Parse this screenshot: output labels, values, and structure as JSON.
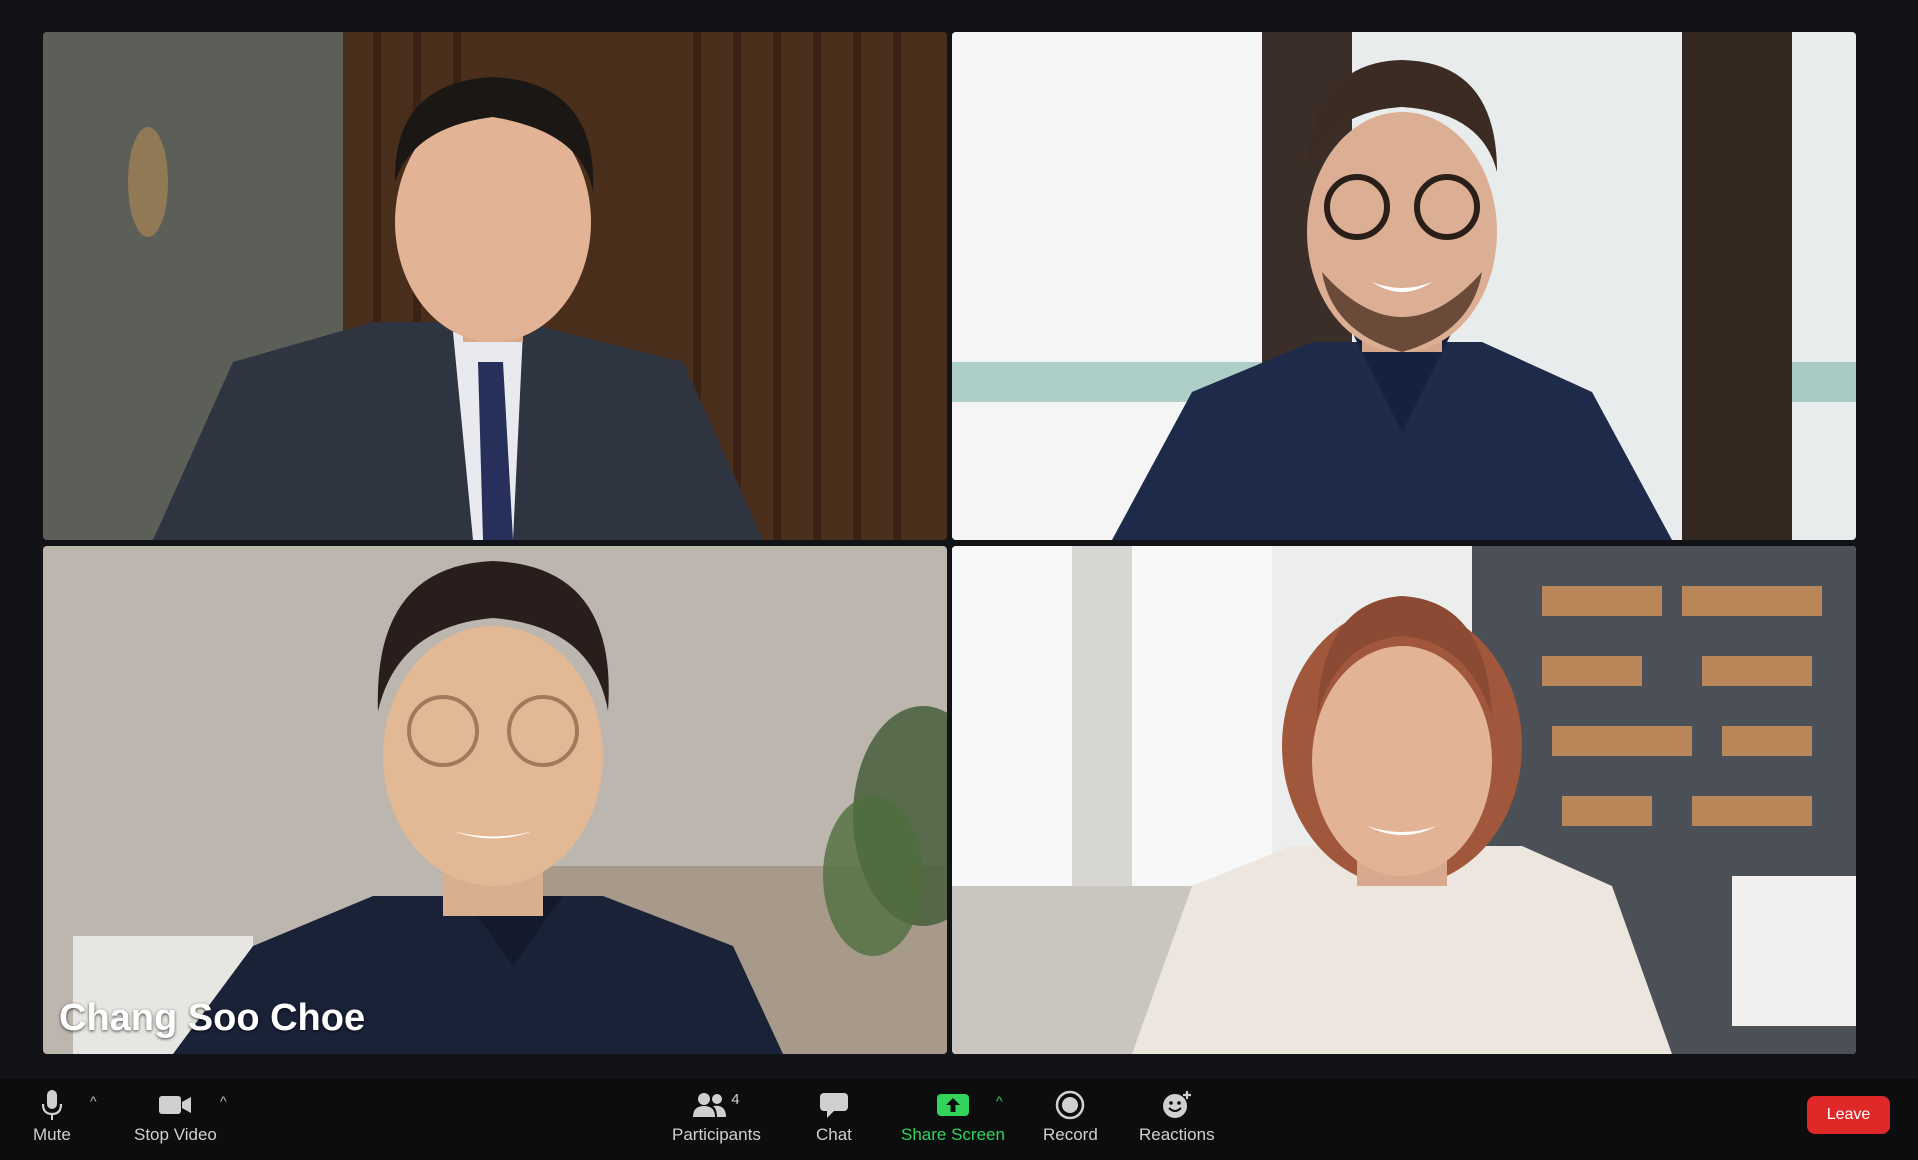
{
  "participants": [
    {
      "name": ""
    },
    {
      "name": ""
    },
    {
      "name": "Chang Soo Choe"
    },
    {
      "name": ""
    }
  ],
  "toolbar": {
    "mute_label": "Mute",
    "stop_video_label": "Stop Video",
    "participants_label": "Participants",
    "participants_count": "4",
    "chat_label": "Chat",
    "share_screen_label": "Share Screen",
    "record_label": "Record",
    "reactions_label": "Reactions",
    "leave_label": "Leave"
  },
  "icons": {
    "mute": "microphone-icon",
    "video": "video-camera-icon",
    "participants": "people-icon",
    "chat": "chat-bubble-icon",
    "share": "share-screen-icon",
    "record": "record-icon",
    "reactions": "smiley-plus-icon"
  },
  "colors": {
    "active_speaker": "#2ecc52",
    "share_green": "#33d35c",
    "leave_red": "#e02828",
    "toolbar_bg": "#0c0d0f"
  }
}
